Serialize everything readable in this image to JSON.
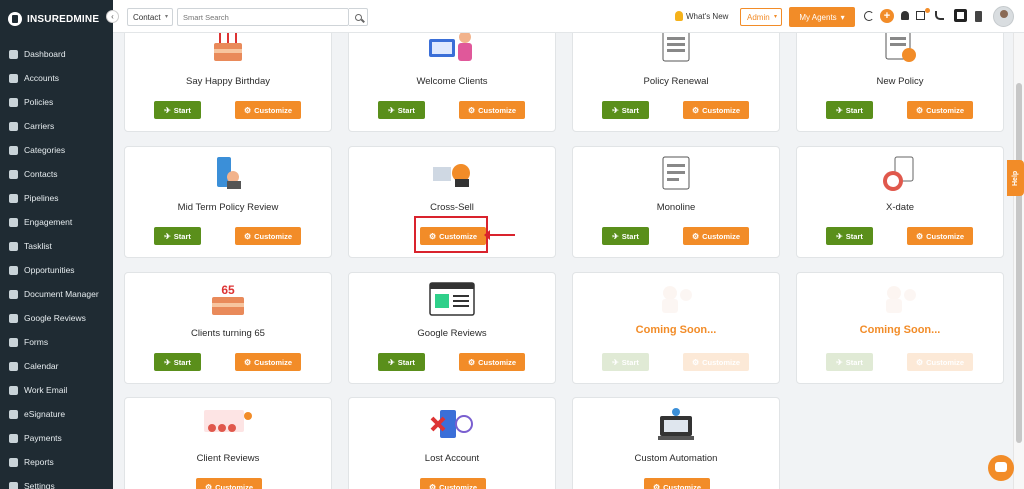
{
  "brand": {
    "name": "INSUREDMINE"
  },
  "sidebar": {
    "collapse_glyph": "‹",
    "items": [
      {
        "label": "Dashboard",
        "icon": "dashboard-icon"
      },
      {
        "label": "Accounts",
        "icon": "accounts-icon"
      },
      {
        "label": "Policies",
        "icon": "policies-icon"
      },
      {
        "label": "Carriers",
        "icon": "carriers-icon"
      },
      {
        "label": "Categories",
        "icon": "categories-icon"
      },
      {
        "label": "Contacts",
        "icon": "contacts-icon"
      },
      {
        "label": "Pipelines",
        "icon": "pipelines-icon"
      },
      {
        "label": "Engagement",
        "icon": "engagement-icon"
      },
      {
        "label": "Tasklist",
        "icon": "tasklist-icon"
      },
      {
        "label": "Opportunities",
        "icon": "opportunities-icon"
      },
      {
        "label": "Document Manager",
        "icon": "folder-icon"
      },
      {
        "label": "Google Reviews",
        "icon": "google-icon"
      },
      {
        "label": "Forms",
        "icon": "forms-icon"
      },
      {
        "label": "Calendar",
        "icon": "calendar-icon"
      },
      {
        "label": "Work Email",
        "icon": "email-icon"
      },
      {
        "label": "eSignature",
        "icon": "signature-icon"
      },
      {
        "label": "Payments",
        "icon": "payments-icon"
      },
      {
        "label": "Reports",
        "icon": "reports-icon"
      },
      {
        "label": "Settings",
        "icon": "settings-icon"
      }
    ]
  },
  "topbar": {
    "contact_select": "Contact",
    "search_placeholder": "Smart Search",
    "whats_new": "What's New",
    "admin_select": "Admin",
    "my_agents": "My Agents",
    "plus_glyph": "+",
    "caret_glyph": "▾",
    "accent_color": "#f28c28"
  },
  "buttons": {
    "start": "Start",
    "customize": "Customize",
    "start_glyph": "✈",
    "customize_glyph": "⚙"
  },
  "cards": [
    {
      "title": "Say Happy Birthday",
      "icon": "birthday-cake-icon",
      "start": true
    },
    {
      "title": "Welcome Clients",
      "icon": "welcome-icon",
      "start": true
    },
    {
      "title": "Policy Renewal",
      "icon": "policy-document-icon",
      "start": true
    },
    {
      "title": "New Policy",
      "icon": "new-policy-icon",
      "start": true
    },
    {
      "title": "Mid Term Policy Review",
      "icon": "review-icon",
      "start": true
    },
    {
      "title": "Cross-Sell",
      "icon": "cross-sell-icon",
      "start": false
    },
    {
      "title": "Monoline",
      "icon": "monoline-icon",
      "start": true
    },
    {
      "title": "X-date",
      "icon": "stopwatch-icon",
      "start": true
    },
    {
      "title": "Clients turning 65",
      "icon": "cake-65-icon",
      "start": true
    },
    {
      "title": "Google Reviews",
      "icon": "browser-window-icon",
      "start": true
    },
    {
      "title": "Coming Soon...",
      "icon": "coming-soon-icon",
      "start": true,
      "disabled": true
    },
    {
      "title": "Coming Soon...",
      "icon": "coming-soon-icon",
      "start": true,
      "disabled": true
    },
    {
      "title": "Client Reviews",
      "icon": "client-reviews-icon",
      "start": false
    },
    {
      "title": "Lost Account",
      "icon": "lost-account-icon",
      "start": false
    },
    {
      "title": "Custom Automation",
      "icon": "custom-automation-icon",
      "start": false
    }
  ],
  "help_tab": "Help",
  "colors": {
    "sidebar_bg": "#1f2b33",
    "start_green": "#5a8f1b",
    "accent_orange": "#f28c28",
    "highlight_red": "#d9232d"
  }
}
